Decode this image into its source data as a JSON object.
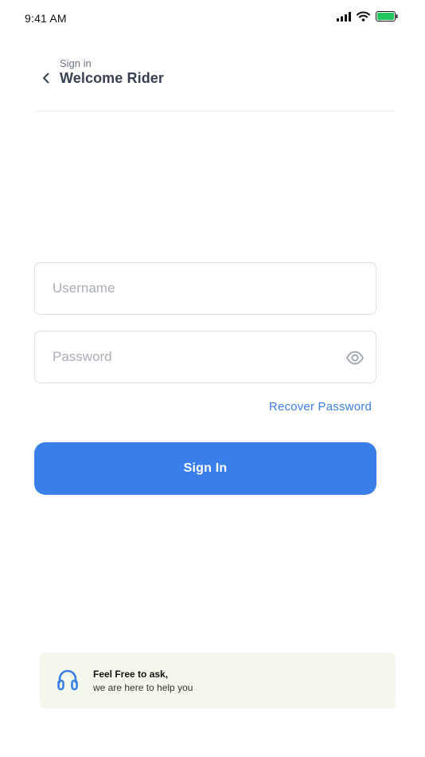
{
  "status_bar": {
    "time": "9:41 AM",
    "icons": [
      "cellular-signal-icon",
      "wifi-icon",
      "battery-icon"
    ],
    "battery_color": "#22c55e"
  },
  "header": {
    "subtitle": "Sign in",
    "title": "Welcome Rider",
    "back_icon": "chevron-left-icon"
  },
  "form": {
    "username": {
      "value": "",
      "placeholder": "Username"
    },
    "password": {
      "value": "",
      "placeholder": "Password",
      "toggle_icon": "eye-icon"
    },
    "recover_label": "Recover Password",
    "submit_label": "Sign In"
  },
  "help": {
    "icon": "headphones-icon",
    "title": "Feel Free to ask,",
    "subtitle": "we are here to help you"
  },
  "colors": {
    "accent": "#3a7fe9",
    "link": "#3a7fe6",
    "help_background": "#f4f7ec"
  }
}
